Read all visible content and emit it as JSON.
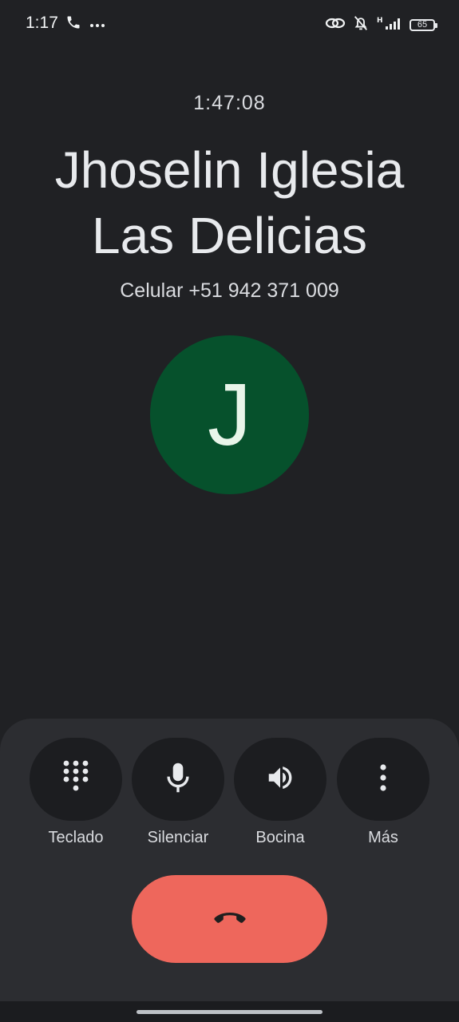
{
  "status_bar": {
    "time": "1:17",
    "network_label": "H",
    "battery": "65",
    "icons": [
      "phone-icon",
      "more-dots-icon",
      "link-icon",
      "notifications-off-icon",
      "signal-icon",
      "battery-icon"
    ]
  },
  "call": {
    "duration": "1:47:08",
    "contact_name_line1": "Jhoselin Iglesia",
    "contact_name_line2": "Las Delicias",
    "phone_line": "Celular +51 942 371 009",
    "avatar_letter": "J",
    "avatar_color": "#06512c"
  },
  "actions": {
    "keypad": {
      "label": "Teclado",
      "icon": "dialpad-icon"
    },
    "mute": {
      "label": "Silenciar",
      "icon": "microphone-icon"
    },
    "speaker": {
      "label": "Bocina",
      "icon": "speaker-icon"
    },
    "more": {
      "label": "Más",
      "icon": "more-vert-icon"
    }
  },
  "end_call": {
    "icon": "call-end-icon",
    "color": "#ee675c"
  }
}
